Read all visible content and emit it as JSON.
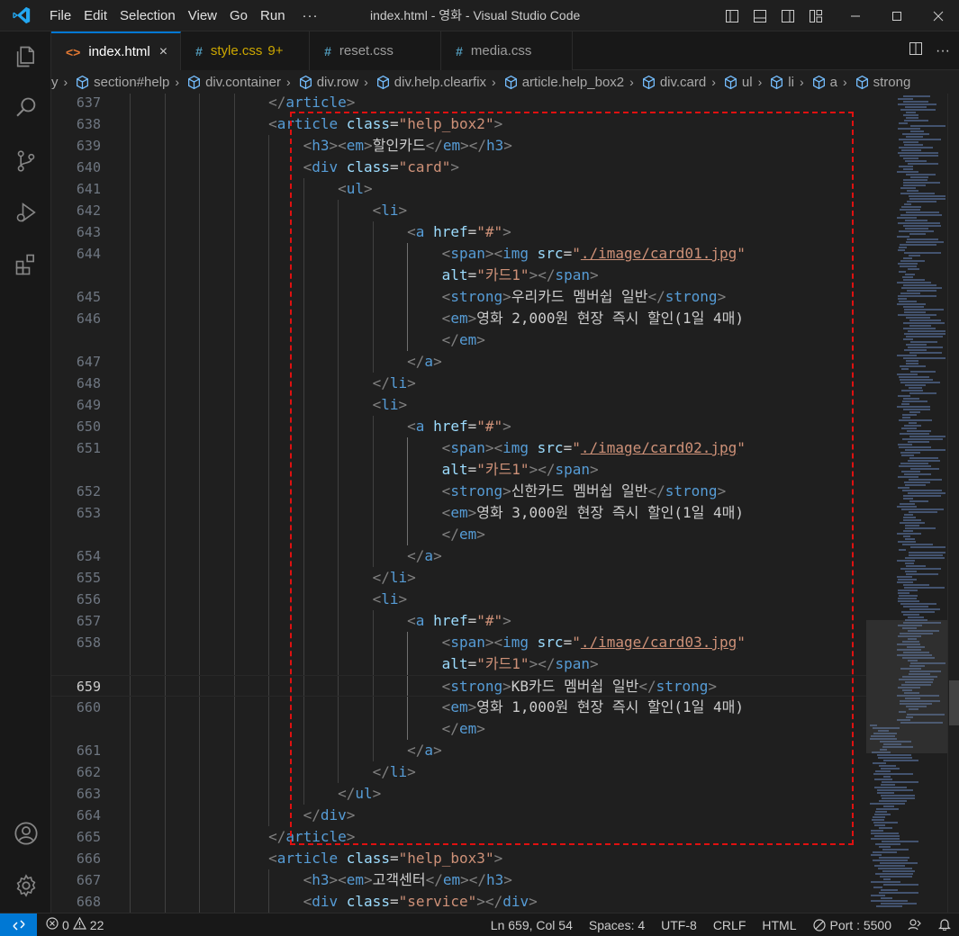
{
  "titlebar": {
    "menu": [
      "File",
      "Edit",
      "Selection",
      "View",
      "Go",
      "Run"
    ],
    "more": "···",
    "window_title": "index.html - 영화 - Visual Studio Code"
  },
  "tabs": [
    {
      "label": "index.html",
      "icon": "html-file-icon",
      "active": true,
      "close": "×"
    },
    {
      "label": "style.css",
      "icon": "css-file-icon",
      "badge": "9+",
      "warning": true
    },
    {
      "label": "reset.css",
      "icon": "css-file-icon"
    },
    {
      "label": "media.css",
      "icon": "css-file-icon"
    }
  ],
  "breadcrumb": {
    "lead_sep": "y",
    "items": [
      "section#help",
      "div.container",
      "div.row",
      "div.help.clearfix",
      "article.help_box2",
      "div.card",
      "ul",
      "li",
      "a",
      "strong"
    ]
  },
  "editor": {
    "current_line": 659,
    "rows": [
      {
        "num": "637",
        "indent": 5,
        "tokens": [
          [
            "punc",
            "</"
          ],
          [
            "tag",
            "article"
          ],
          [
            "punc",
            ">"
          ]
        ]
      },
      {
        "num": "638",
        "indent": 5,
        "tokens": [
          [
            "punc",
            "<"
          ],
          [
            "tag",
            "article"
          ],
          [
            "text",
            " "
          ],
          [
            "attr",
            "class"
          ],
          [
            "eq",
            "="
          ],
          [
            "str",
            "\"help_box2\""
          ],
          [
            "punc",
            ">"
          ]
        ]
      },
      {
        "num": "639",
        "indent": 6,
        "tokens": [
          [
            "punc",
            "<"
          ],
          [
            "tag",
            "h3"
          ],
          [
            "punc",
            "><"
          ],
          [
            "tag",
            "em"
          ],
          [
            "punc",
            ">"
          ],
          [
            "text",
            "할인카드"
          ],
          [
            "punc",
            "</"
          ],
          [
            "tag",
            "em"
          ],
          [
            "punc",
            "></"
          ],
          [
            "tag",
            "h3"
          ],
          [
            "punc",
            ">"
          ]
        ]
      },
      {
        "num": "640",
        "indent": 6,
        "tokens": [
          [
            "punc",
            "<"
          ],
          [
            "tag",
            "div"
          ],
          [
            "text",
            " "
          ],
          [
            "attr",
            "class"
          ],
          [
            "eq",
            "="
          ],
          [
            "str",
            "\"card\""
          ],
          [
            "punc",
            ">"
          ]
        ]
      },
      {
        "num": "641",
        "indent": 7,
        "tokens": [
          [
            "punc",
            "<"
          ],
          [
            "tag",
            "ul"
          ],
          [
            "punc",
            ">"
          ]
        ]
      },
      {
        "num": "642",
        "indent": 8,
        "tokens": [
          [
            "punc",
            "<"
          ],
          [
            "tag",
            "li"
          ],
          [
            "punc",
            ">"
          ]
        ]
      },
      {
        "num": "643",
        "indent": 9,
        "tokens": [
          [
            "punc",
            "<"
          ],
          [
            "tag",
            "a"
          ],
          [
            "text",
            " "
          ],
          [
            "attr",
            "href"
          ],
          [
            "eq",
            "="
          ],
          [
            "str",
            "\"#\""
          ],
          [
            "punc",
            ">"
          ]
        ]
      },
      {
        "num": "644",
        "indent": 10,
        "tokens": [
          [
            "punc",
            "<"
          ],
          [
            "tag",
            "span"
          ],
          [
            "punc",
            "><"
          ],
          [
            "tag",
            "img"
          ],
          [
            "text",
            " "
          ],
          [
            "attr",
            "src"
          ],
          [
            "eq",
            "="
          ],
          [
            "str",
            "\""
          ],
          [
            "link",
            "./image/card01.jpg"
          ],
          [
            "str",
            "\""
          ]
        ]
      },
      {
        "num": "",
        "indent": 10,
        "tokens": [
          [
            "attr",
            "alt"
          ],
          [
            "eq",
            "="
          ],
          [
            "str",
            "\"카드1\""
          ],
          [
            "punc",
            "></"
          ],
          [
            "tag",
            "span"
          ],
          [
            "punc",
            ">"
          ]
        ]
      },
      {
        "num": "645",
        "indent": 10,
        "tokens": [
          [
            "punc",
            "<"
          ],
          [
            "tag",
            "strong"
          ],
          [
            "punc",
            ">"
          ],
          [
            "text",
            "우리카드 멤버쉽 일반"
          ],
          [
            "punc",
            "</"
          ],
          [
            "tag",
            "strong"
          ],
          [
            "punc",
            ">"
          ]
        ]
      },
      {
        "num": "646",
        "indent": 10,
        "tokens": [
          [
            "punc",
            "<"
          ],
          [
            "tag",
            "em"
          ],
          [
            "punc",
            ">"
          ],
          [
            "text",
            "영화 2,000원 현장 즉시 할인(1일 4매)"
          ]
        ]
      },
      {
        "num": "",
        "indent": 10,
        "tokens": [
          [
            "punc",
            "</"
          ],
          [
            "tag",
            "em"
          ],
          [
            "punc",
            ">"
          ]
        ]
      },
      {
        "num": "647",
        "indent": 9,
        "tokens": [
          [
            "punc",
            "</"
          ],
          [
            "tag",
            "a"
          ],
          [
            "punc",
            ">"
          ]
        ]
      },
      {
        "num": "648",
        "indent": 8,
        "tokens": [
          [
            "punc",
            "</"
          ],
          [
            "tag",
            "li"
          ],
          [
            "punc",
            ">"
          ]
        ]
      },
      {
        "num": "649",
        "indent": 8,
        "tokens": [
          [
            "punc",
            "<"
          ],
          [
            "tag",
            "li"
          ],
          [
            "punc",
            ">"
          ]
        ]
      },
      {
        "num": "650",
        "indent": 9,
        "tokens": [
          [
            "punc",
            "<"
          ],
          [
            "tag",
            "a"
          ],
          [
            "text",
            " "
          ],
          [
            "attr",
            "href"
          ],
          [
            "eq",
            "="
          ],
          [
            "str",
            "\"#\""
          ],
          [
            "punc",
            ">"
          ]
        ]
      },
      {
        "num": "651",
        "indent": 10,
        "tokens": [
          [
            "punc",
            "<"
          ],
          [
            "tag",
            "span"
          ],
          [
            "punc",
            "><"
          ],
          [
            "tag",
            "img"
          ],
          [
            "text",
            " "
          ],
          [
            "attr",
            "src"
          ],
          [
            "eq",
            "="
          ],
          [
            "str",
            "\""
          ],
          [
            "link",
            "./image/card02.jpg"
          ],
          [
            "str",
            "\""
          ]
        ]
      },
      {
        "num": "",
        "indent": 10,
        "tokens": [
          [
            "attr",
            "alt"
          ],
          [
            "eq",
            "="
          ],
          [
            "str",
            "\"카드1\""
          ],
          [
            "punc",
            "></"
          ],
          [
            "tag",
            "span"
          ],
          [
            "punc",
            ">"
          ]
        ]
      },
      {
        "num": "652",
        "indent": 10,
        "tokens": [
          [
            "punc",
            "<"
          ],
          [
            "tag",
            "strong"
          ],
          [
            "punc",
            ">"
          ],
          [
            "text",
            "신한카드 멤버쉽 일반"
          ],
          [
            "punc",
            "</"
          ],
          [
            "tag",
            "strong"
          ],
          [
            "punc",
            ">"
          ]
        ]
      },
      {
        "num": "653",
        "indent": 10,
        "tokens": [
          [
            "punc",
            "<"
          ],
          [
            "tag",
            "em"
          ],
          [
            "punc",
            ">"
          ],
          [
            "text",
            "영화 3,000원 현장 즉시 할인(1일 4매)"
          ]
        ]
      },
      {
        "num": "",
        "indent": 10,
        "tokens": [
          [
            "punc",
            "</"
          ],
          [
            "tag",
            "em"
          ],
          [
            "punc",
            ">"
          ]
        ]
      },
      {
        "num": "654",
        "indent": 9,
        "tokens": [
          [
            "punc",
            "</"
          ],
          [
            "tag",
            "a"
          ],
          [
            "punc",
            ">"
          ]
        ]
      },
      {
        "num": "655",
        "indent": 8,
        "tokens": [
          [
            "punc",
            "</"
          ],
          [
            "tag",
            "li"
          ],
          [
            "punc",
            ">"
          ]
        ]
      },
      {
        "num": "656",
        "indent": 8,
        "tokens": [
          [
            "punc",
            "<"
          ],
          [
            "tag",
            "li"
          ],
          [
            "punc",
            ">"
          ]
        ]
      },
      {
        "num": "657",
        "indent": 9,
        "tokens": [
          [
            "punc",
            "<"
          ],
          [
            "tag",
            "a"
          ],
          [
            "text",
            " "
          ],
          [
            "attr",
            "href"
          ],
          [
            "eq",
            "="
          ],
          [
            "str",
            "\"#\""
          ],
          [
            "punc",
            ">"
          ]
        ]
      },
      {
        "num": "658",
        "indent": 10,
        "tokens": [
          [
            "punc",
            "<"
          ],
          [
            "tag",
            "span"
          ],
          [
            "punc",
            "><"
          ],
          [
            "tag",
            "img"
          ],
          [
            "text",
            " "
          ],
          [
            "attr",
            "src"
          ],
          [
            "eq",
            "="
          ],
          [
            "str",
            "\""
          ],
          [
            "link",
            "./image/card03.jpg"
          ],
          [
            "str",
            "\""
          ]
        ]
      },
      {
        "num": "",
        "indent": 10,
        "tokens": [
          [
            "attr",
            "alt"
          ],
          [
            "eq",
            "="
          ],
          [
            "str",
            "\"카드1\""
          ],
          [
            "punc",
            "></"
          ],
          [
            "tag",
            "span"
          ],
          [
            "punc",
            ">"
          ]
        ]
      },
      {
        "num": "659",
        "indent": 10,
        "tokens": [
          [
            "punc",
            "<"
          ],
          [
            "tag",
            "strong"
          ],
          [
            "punc",
            ">"
          ],
          [
            "text",
            "KB카드 멤버쉽 일반"
          ],
          [
            "punc",
            "</"
          ],
          [
            "tag",
            "strong"
          ],
          [
            "punc",
            ">"
          ]
        ]
      },
      {
        "num": "660",
        "indent": 10,
        "tokens": [
          [
            "punc",
            "<"
          ],
          [
            "tag",
            "em"
          ],
          [
            "punc",
            ">"
          ],
          [
            "text",
            "영화 1,000원 현장 즉시 할인(1일 4매)"
          ]
        ]
      },
      {
        "num": "",
        "indent": 10,
        "tokens": [
          [
            "punc",
            "</"
          ],
          [
            "tag",
            "em"
          ],
          [
            "punc",
            ">"
          ]
        ]
      },
      {
        "num": "661",
        "indent": 9,
        "tokens": [
          [
            "punc",
            "</"
          ],
          [
            "tag",
            "a"
          ],
          [
            "punc",
            ">"
          ]
        ]
      },
      {
        "num": "662",
        "indent": 8,
        "tokens": [
          [
            "punc",
            "</"
          ],
          [
            "tag",
            "li"
          ],
          [
            "punc",
            ">"
          ]
        ]
      },
      {
        "num": "663",
        "indent": 7,
        "tokens": [
          [
            "punc",
            "</"
          ],
          [
            "tag",
            "ul"
          ],
          [
            "punc",
            ">"
          ]
        ]
      },
      {
        "num": "664",
        "indent": 6,
        "tokens": [
          [
            "punc",
            "</"
          ],
          [
            "tag",
            "div"
          ],
          [
            "punc",
            ">"
          ]
        ]
      },
      {
        "num": "665",
        "indent": 5,
        "tokens": [
          [
            "punc",
            "</"
          ],
          [
            "tag",
            "article"
          ],
          [
            "punc",
            ">"
          ]
        ]
      },
      {
        "num": "666",
        "indent": 5,
        "tokens": [
          [
            "punc",
            "<"
          ],
          [
            "tag",
            "article"
          ],
          [
            "text",
            " "
          ],
          [
            "attr",
            "class"
          ],
          [
            "eq",
            "="
          ],
          [
            "str",
            "\"help_box3\""
          ],
          [
            "punc",
            ">"
          ]
        ]
      },
      {
        "num": "667",
        "indent": 6,
        "tokens": [
          [
            "punc",
            "<"
          ],
          [
            "tag",
            "h3"
          ],
          [
            "punc",
            "><"
          ],
          [
            "tag",
            "em"
          ],
          [
            "punc",
            ">"
          ],
          [
            "text",
            "고객센터"
          ],
          [
            "punc",
            "</"
          ],
          [
            "tag",
            "em"
          ],
          [
            "punc",
            "></"
          ],
          [
            "tag",
            "h3"
          ],
          [
            "punc",
            ">"
          ]
        ]
      },
      {
        "num": "668",
        "indent": 6,
        "tokens": [
          [
            "punc",
            "<"
          ],
          [
            "tag",
            "div"
          ],
          [
            "text",
            " "
          ],
          [
            "attr",
            "class"
          ],
          [
            "eq",
            "="
          ],
          [
            "str",
            "\"service\""
          ],
          [
            "punc",
            "></"
          ],
          [
            "tag",
            "div"
          ],
          [
            "punc",
            ">"
          ]
        ]
      }
    ]
  },
  "statusbar": {
    "errors": "0",
    "warnings": "22",
    "position": "Ln 659, Col 54",
    "spaces": "Spaces: 4",
    "encoding": "UTF-8",
    "eol": "CRLF",
    "language": "HTML",
    "port": "Port : 5500"
  },
  "colors": {
    "accent": "#0078d4",
    "highlight_box": "#e01010",
    "tag": "#569cd6",
    "attr": "#9cdcfe",
    "string": "#ce9178"
  }
}
